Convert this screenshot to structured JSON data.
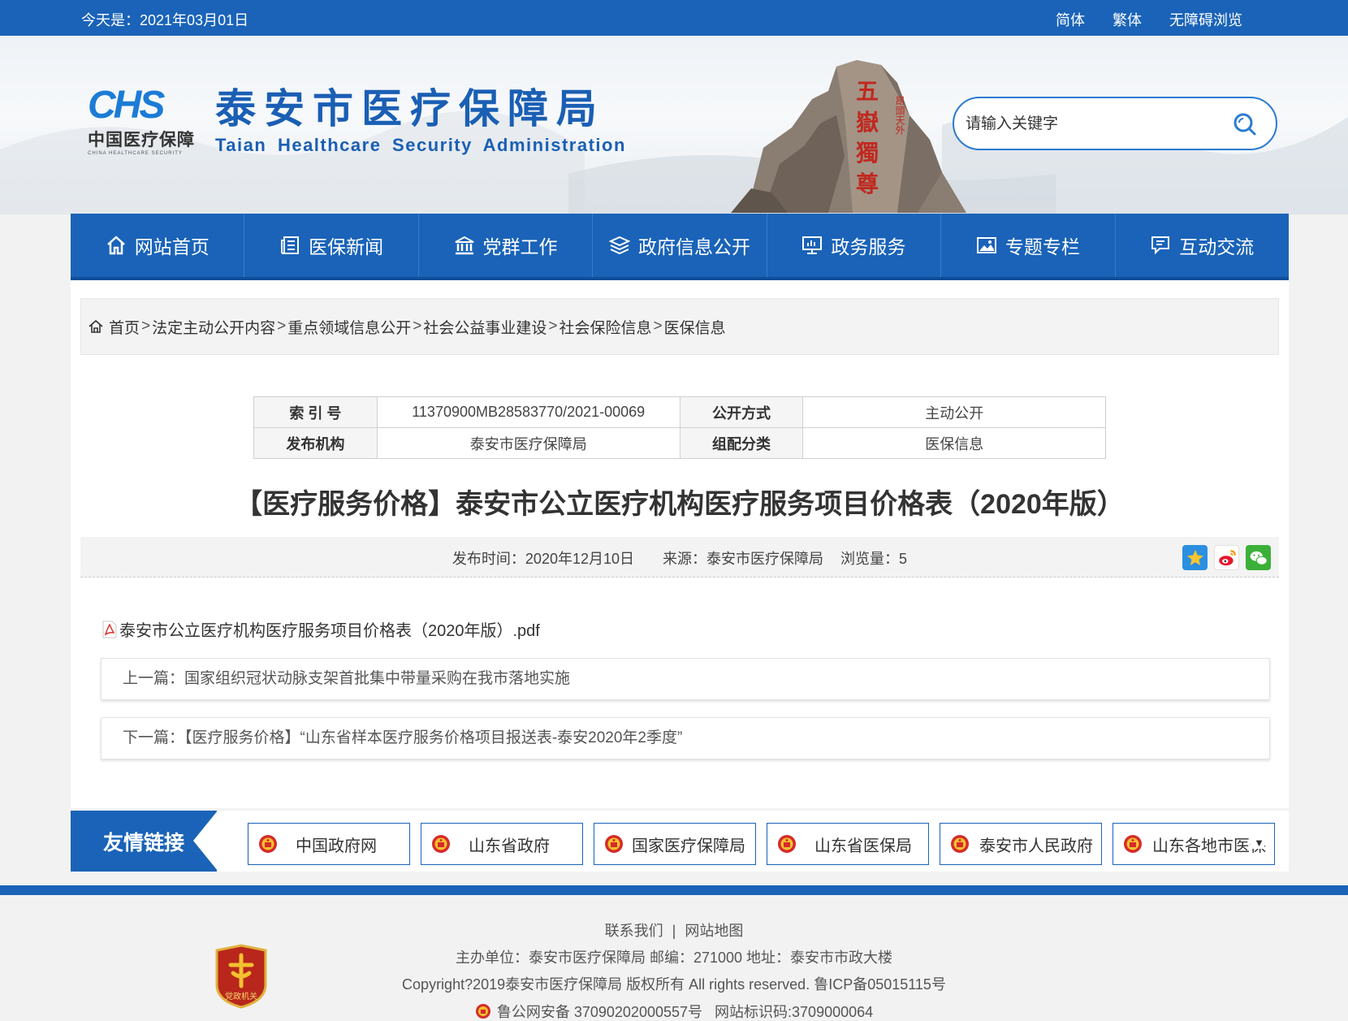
{
  "topbar": {
    "date": "今天是：2021年03月01日",
    "simplified": "简体",
    "traditional": "繁体",
    "accessible": "无障碍浏览"
  },
  "header": {
    "logo_text": "CHS",
    "logo_cn": "中国医疗保障",
    "logo_en": "CHINA HEALTHCARE SECURITY",
    "title_cn": "泰安市医疗保障局",
    "title_en": "Taian Healthcare Security Administration",
    "rock_text": "五嶽獨尊",
    "rock_side_text": "昂頭天外",
    "search_placeholder": "请输入关键字"
  },
  "nav": {
    "items": [
      {
        "label": "网站首页",
        "icon": "home-icon"
      },
      {
        "label": "医保新闻",
        "icon": "news-icon"
      },
      {
        "label": "党群工作",
        "icon": "building-icon"
      },
      {
        "label": "政府信息公开",
        "icon": "layers-icon"
      },
      {
        "label": "政务服务",
        "icon": "monitor-icon"
      },
      {
        "label": "专题专栏",
        "icon": "image-icon"
      },
      {
        "label": "互动交流",
        "icon": "chat-icon"
      }
    ]
  },
  "breadcrumb": {
    "items": [
      "首页",
      "法定主动公开内容",
      "重点领域信息公开",
      "社会公益事业建设",
      "社会保险信息",
      "医保信息"
    ],
    "separator": ">"
  },
  "meta": {
    "index_label": "索 引 号",
    "index_value": "11370900MB28583770/2021-00069",
    "method_label": "公开方式",
    "method_value": "主动公开",
    "publisher_label": "发布机构",
    "publisher_value": "泰安市医疗保障局",
    "category_label": "组配分类",
    "category_value": "医保信息"
  },
  "article": {
    "title": "【医疗服务价格】泰安市公立医疗机构医疗服务项目价格表（2020年版）",
    "publish_label": "发布时间：",
    "publish_date": "2020年12月10日",
    "source_label": "来源：",
    "source": "泰安市医疗保障局",
    "views_label": "浏览量：",
    "views": "5",
    "attachment": "泰安市公立医疗机构医疗服务项目价格表（2020年版）.pdf",
    "prev": "上一篇：国家组织冠状动脉支架首批集中带量采购在我市落地实施",
    "next": "下一篇：【医疗服务价格】“山东省样本医疗服务价格项目报送表-泰安2020年2季度”"
  },
  "friend_links": {
    "label": "友情链接",
    "items": [
      "中国政府网",
      "山东省政府",
      "国家医疗保障局",
      "山东省医保局",
      "泰安市人民政府",
      "山东各地市医保"
    ],
    "dropdown_arrow": "▼"
  },
  "footer": {
    "contact": "联系我们",
    "divider": "|",
    "sitemap": "网站地图",
    "host": "主办单位：泰安市医疗保障局 邮编：271000 地址：泰安市市政大楼",
    "copyright": "Copyright?2019泰安市医疗保障局 版权所有 All rights reserved. 鲁ICP备05015115号",
    "police": "鲁公网安备 37090202000557号",
    "site_id": "网站标识码:3709000064",
    "badge_text": "党政机关"
  },
  "colors": {
    "primary": "#1a63b8",
    "accent": "#1c7bd6"
  }
}
